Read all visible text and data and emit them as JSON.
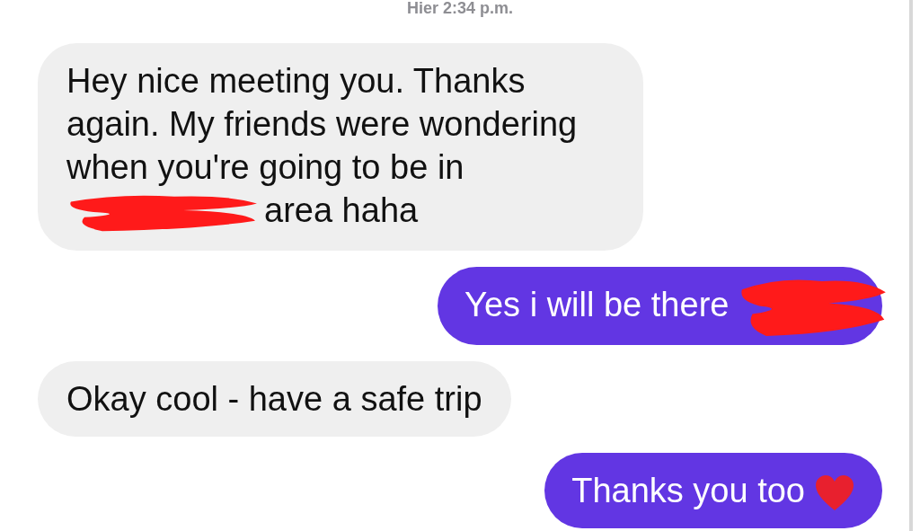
{
  "timestamp": "Hier 2:34 p.m.",
  "messages": [
    {
      "kind": "received",
      "text": "Hey nice meeting you. Thanks again. My friends were wondering when you're going to be in",
      "redacted": true,
      "text_after": "area haha"
    },
    {
      "kind": "sent",
      "text": "Yes i will be there",
      "redacted": true,
      "heart": false
    },
    {
      "kind": "received",
      "text": "Okay cool - have a safe trip",
      "redacted": false
    },
    {
      "kind": "sent",
      "text": "Thanks you too",
      "redacted": false,
      "heart": true
    }
  ]
}
